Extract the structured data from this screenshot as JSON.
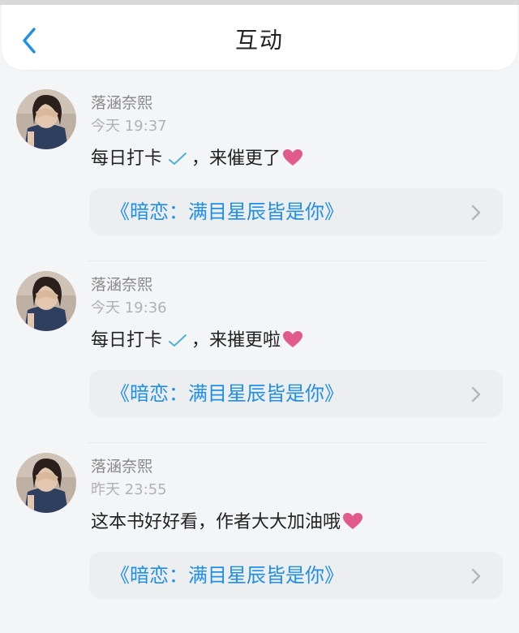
{
  "header": {
    "title": "互动",
    "back_icon": "chevron-left-icon"
  },
  "colors": {
    "accent": "#1e8fe8",
    "heart": "#e05a8a",
    "check": "#4ab3d6",
    "card_bg": "#edeef0",
    "page_bg": "#f4f5f7"
  },
  "comments": [
    {
      "username": "落涵奈熙",
      "time": "今天 19:37",
      "text_before": "每日打卡",
      "text_after": "，来催更了",
      "book": "《暗恋：满目星辰皆是你》"
    },
    {
      "username": "落涵奈熙",
      "time": "今天 19:36",
      "text_before": "每日打卡",
      "text_after": "，来摧更啦",
      "book": "《暗恋：满目星辰皆是你》"
    },
    {
      "username": "落涵奈熙",
      "time": "昨天 23:55",
      "text_before": "这本书好好看，作者大大加油哦",
      "text_after": "",
      "book": "《暗恋：满目星辰皆是你》"
    }
  ]
}
